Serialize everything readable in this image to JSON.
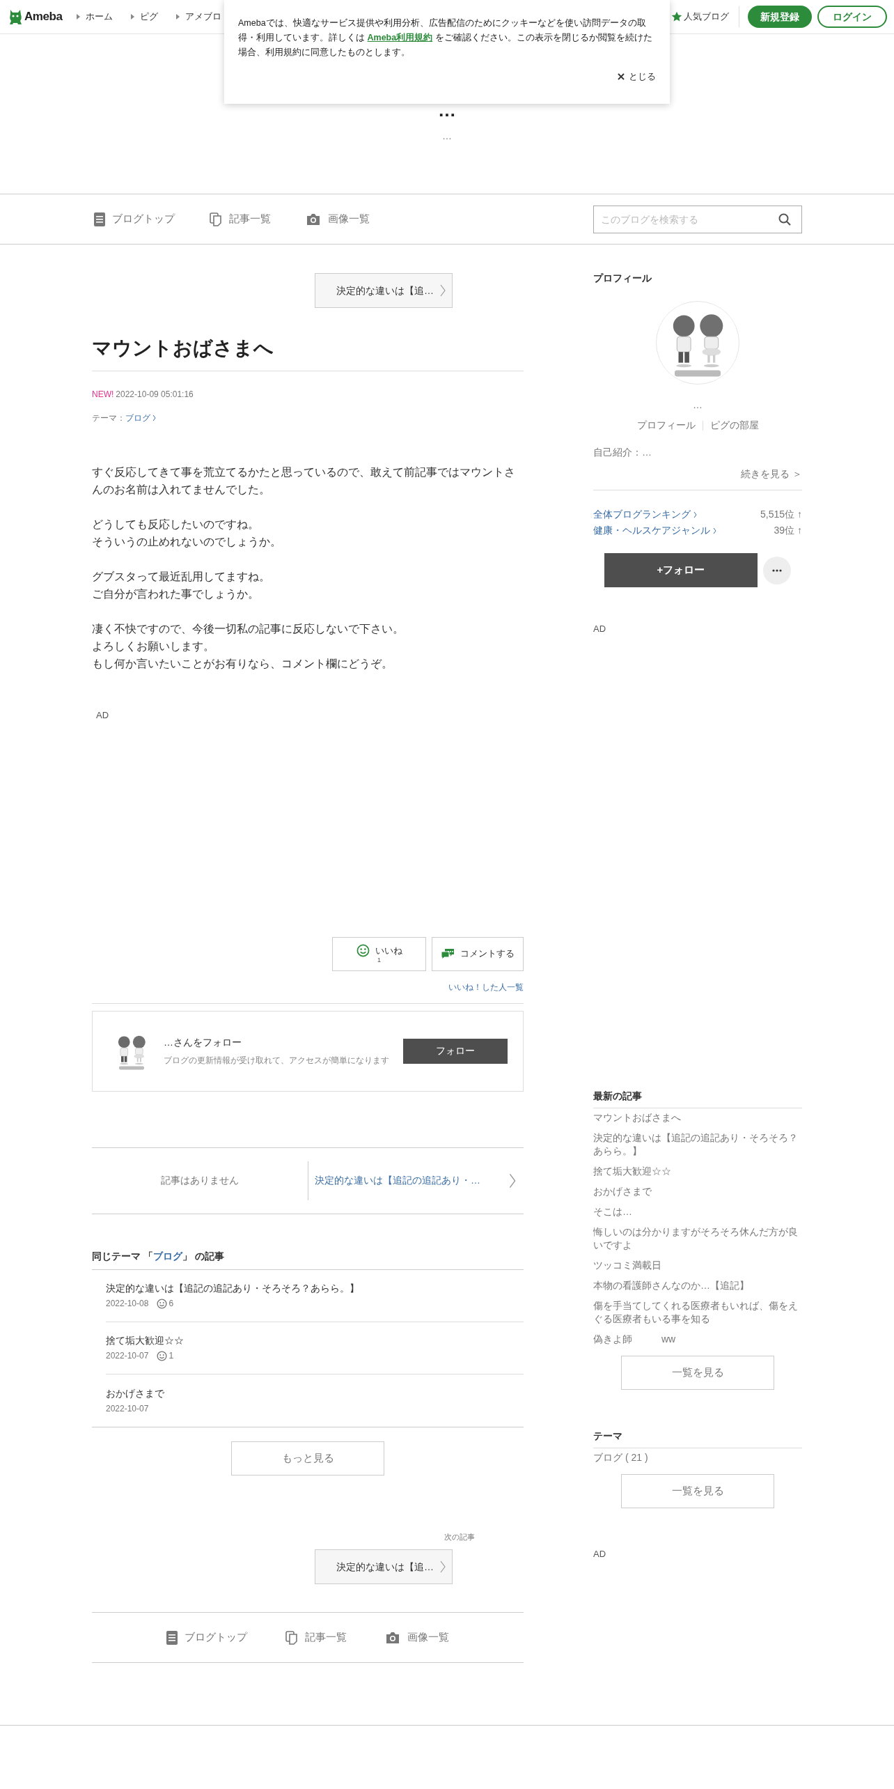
{
  "header": {
    "logo": "Ameba",
    "nav": [
      "ホーム",
      "ピグ",
      "アメブロ"
    ],
    "popular": "人気ブログ",
    "signup": "新規登録",
    "login": "ログイン"
  },
  "cookie_notice": {
    "before": "Amebaでは、快適なサービス提供や利用分析、広告配信のためにクッキーなどを使い訪問データの取得・利用しています。詳しくは ",
    "link": "Ameba利用規約",
    "after": " をご確認ください。この表示を閉じるか閲覧を続けた場合、利用規約に同意したものとします。",
    "close": "とじる"
  },
  "blog_header": {
    "title": "…",
    "description": "…"
  },
  "blog_nav": {
    "items": [
      {
        "label": "ブログトップ",
        "kind": "doc"
      },
      {
        "label": "記事一覧",
        "kind": "pages"
      },
      {
        "label": "画像一覧",
        "kind": "camera"
      }
    ],
    "search": {
      "placeholder": "このブログを検索する"
    }
  },
  "article": {
    "next_button": "決定的な違いは【追…",
    "title": "マウントおばさまへ",
    "new_badge": "NEW!",
    "datetime": "2022-10-09 05:01:16",
    "theme_label": "テーマ：",
    "theme": "ブログ",
    "paragraphs": [
      [
        "すぐ反応してきて事を荒立てるかたと思っているので、敢えて前記事ではマウントさんのお名前は入れてませんでした。"
      ],
      [
        "どうしても反応したいのですね。",
        "そういうの止めれないのでしょうか。"
      ],
      [
        "グブスタって最近乱用してますね。",
        "ご自分が言われた事でしょうか。"
      ],
      [
        "凄く不快ですので、今後一切私の記事に反応しないで下さい。",
        "よろしくお願いします。",
        "もし何か言いたいことがお有りなら、コメント欄にどうぞ。"
      ]
    ],
    "ad": "AD"
  },
  "reactions": {
    "like_label": "いいね",
    "like_count": "1",
    "comment": "コメントする",
    "likers_link": "いいね！した人一覧"
  },
  "follow_card": {
    "title": "…さんをフォロー",
    "description": "ブログの更新情報が受け取れて、アクセスが簡単になります",
    "button": "フォロー"
  },
  "pager": {
    "prev": "記事はありません",
    "next": "決定的な違いは【追記の追記あり・…"
  },
  "same_theme": {
    "before": "同じテーマ 「",
    "theme": "ブログ",
    "after": "」 の記事",
    "articles": [
      {
        "title": "決定的な違いは【追記の追記あり・そろそろ？あらら。】",
        "date": "2022-10-08",
        "likes": "6"
      },
      {
        "title": "捨て垢大歓迎☆☆",
        "date": "2022-10-07",
        "likes": "1"
      },
      {
        "title": "おかげさまで",
        "date": "2022-10-07"
      }
    ],
    "more": "もっと見る"
  },
  "next_article": {
    "label": "次の記事",
    "button": "決定的な違いは【追…"
  },
  "footer_nav": [
    {
      "label": "ブログトップ",
      "kind": "doc"
    },
    {
      "label": "記事一覧",
      "kind": "pages"
    },
    {
      "label": "画像一覧",
      "kind": "camera"
    }
  ],
  "sidebar": {
    "profile": {
      "heading": "プロフィール",
      "name": "…",
      "links": [
        "プロフィール",
        "ピグの部屋"
      ],
      "intro": "自己紹介：…",
      "read_more": "続きを見る ＞",
      "rankings": [
        {
          "label": "全体ブログランキング",
          "value": "5,515位 ↑"
        },
        {
          "label": "健康・ヘルスケアジャンル",
          "value": "39位 ↑"
        }
      ],
      "follow": "+フォロー"
    },
    "ad": "AD",
    "latest": {
      "heading": "最新の記事",
      "items": [
        "マウントおばさまへ",
        "決定的な違いは【追記の追記あり・そろそろ？あらら。】",
        "捨て垢大歓迎☆☆",
        "おかげさまで",
        "そこは…",
        "悔しいのは分かりますがそろそろ休んだ方が良いですよ",
        "ツッコミ満載日",
        "本物の看護師さんなのか…【追記】",
        "傷を手当てしてくれる医療者もいれば、傷をえぐる医療者もいる事を知る",
        "偽きよ師　　　ww"
      ],
      "button": "一覧を見る"
    },
    "themes": {
      "heading": "テーマ",
      "items": [
        "ブログ ( 21 )"
      ],
      "button": "一覧を見る"
    },
    "ad_bottom": "AD"
  }
}
